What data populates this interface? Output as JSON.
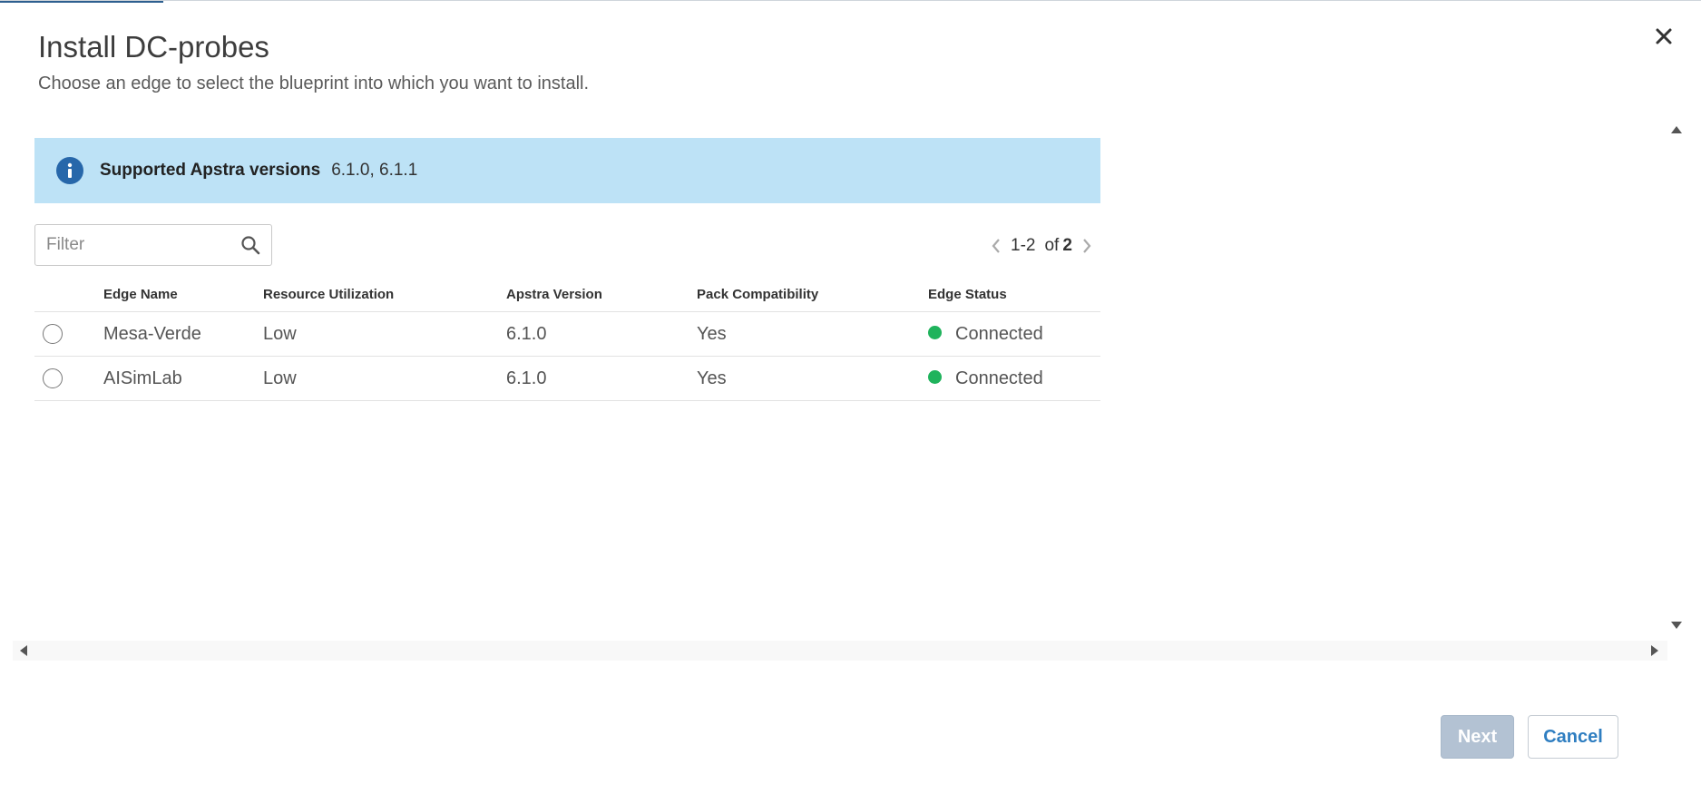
{
  "dialog": {
    "title": "Install DC-probes",
    "subtitle": "Choose an edge to select the blueprint into which you want to install."
  },
  "banner": {
    "label": "Supported Apstra versions",
    "value": "6.1.0, 6.1.1",
    "icon": "info-icon",
    "color": "#bde2f6"
  },
  "filter": {
    "placeholder": "Filter",
    "value": ""
  },
  "pagination": {
    "range": "1-2",
    "of_label": "of",
    "total": "2"
  },
  "table": {
    "headers": [
      "Edge Name",
      "Resource Utilization",
      "Apstra Version",
      "Pack Compatibility",
      "Edge Status"
    ],
    "rows": [
      {
        "edge_name": "Mesa-Verde",
        "resource_utilization": "Low",
        "apstra_version": "6.1.0",
        "pack_compatibility": "Yes",
        "edge_status": "Connected",
        "status_color": "#1fb35c",
        "selected": false
      },
      {
        "edge_name": "AISimLab",
        "resource_utilization": "Low",
        "apstra_version": "6.1.0",
        "pack_compatibility": "Yes",
        "edge_status": "Connected",
        "status_color": "#1fb35c",
        "selected": false
      }
    ]
  },
  "footer": {
    "next_label": "Next",
    "cancel_label": "Cancel"
  }
}
